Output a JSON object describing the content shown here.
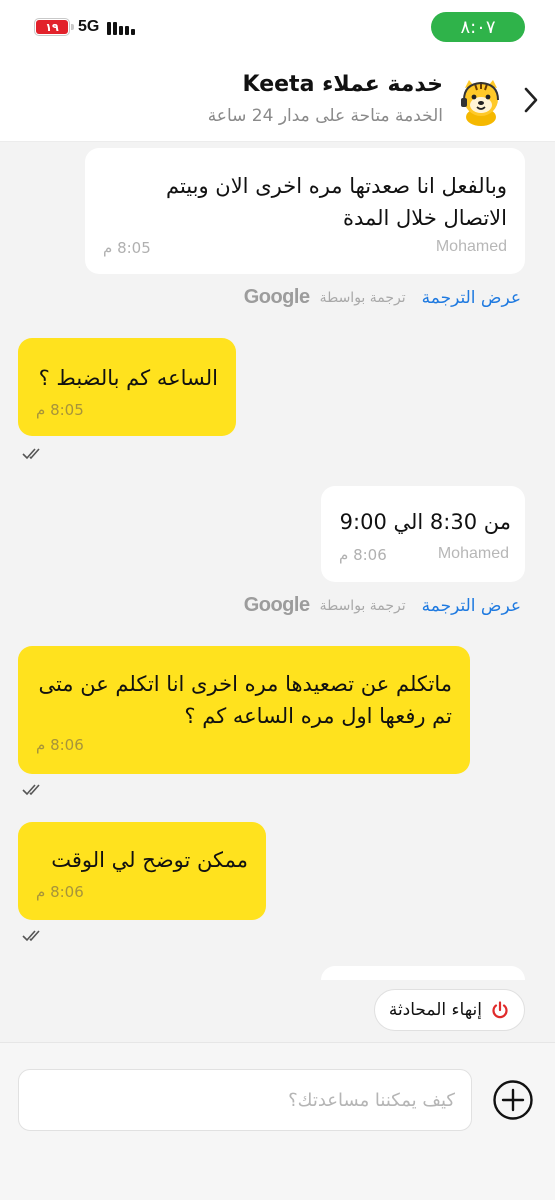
{
  "status_bar": {
    "battery_level": "١٩",
    "network": "5G",
    "time": "٨:٠٧"
  },
  "header": {
    "title": "خدمة عملاء Keeta",
    "subtitle": "الخدمة متاحة على مدار 24 ساعة",
    "back_icon": "chevron-right-icon",
    "avatar_icon": "tiger-mascot-icon"
  },
  "messages": [
    {
      "direction": "in",
      "text": "وبالفعل انا صعدتها مره اخرى الان وبيتم الاتصال خلال المدة",
      "sender": "Mohamed",
      "time": "8:05 م"
    },
    {
      "direction": "out",
      "text": "الساعه كم بالضبط ؟",
      "time": "8:05 م"
    },
    {
      "direction": "in",
      "text": "من 8:30 الي 9:00",
      "sender": "Mohamed",
      "time": "8:06 م"
    },
    {
      "direction": "out",
      "text": "ماتكلم عن تصعيدها مره اخرى انا اتكلم عن متى تم رفعها اول مره الساعه كم ؟",
      "time": "8:06 م"
    },
    {
      "direction": "out",
      "text": "ممكن توضح لي الوقت",
      "time": "8:06 م"
    }
  ],
  "translation": {
    "show_label": "عرض الترجمة",
    "by_label": "ترجمة بواسطة",
    "provider": "Google"
  },
  "end_chat": {
    "label": "إنهاء المحادثة",
    "icon": "power-icon",
    "icon_color": "#e02b2b"
  },
  "composer": {
    "placeholder": "كيف يمكننا مساعدتك؟",
    "value": "",
    "add_icon": "plus-circle-icon"
  },
  "colors": {
    "outgoing_bubble": "#ffe21e",
    "incoming_bubble": "#ffffff",
    "link": "#1f7ae0",
    "time_pill": "#2fb34a"
  }
}
